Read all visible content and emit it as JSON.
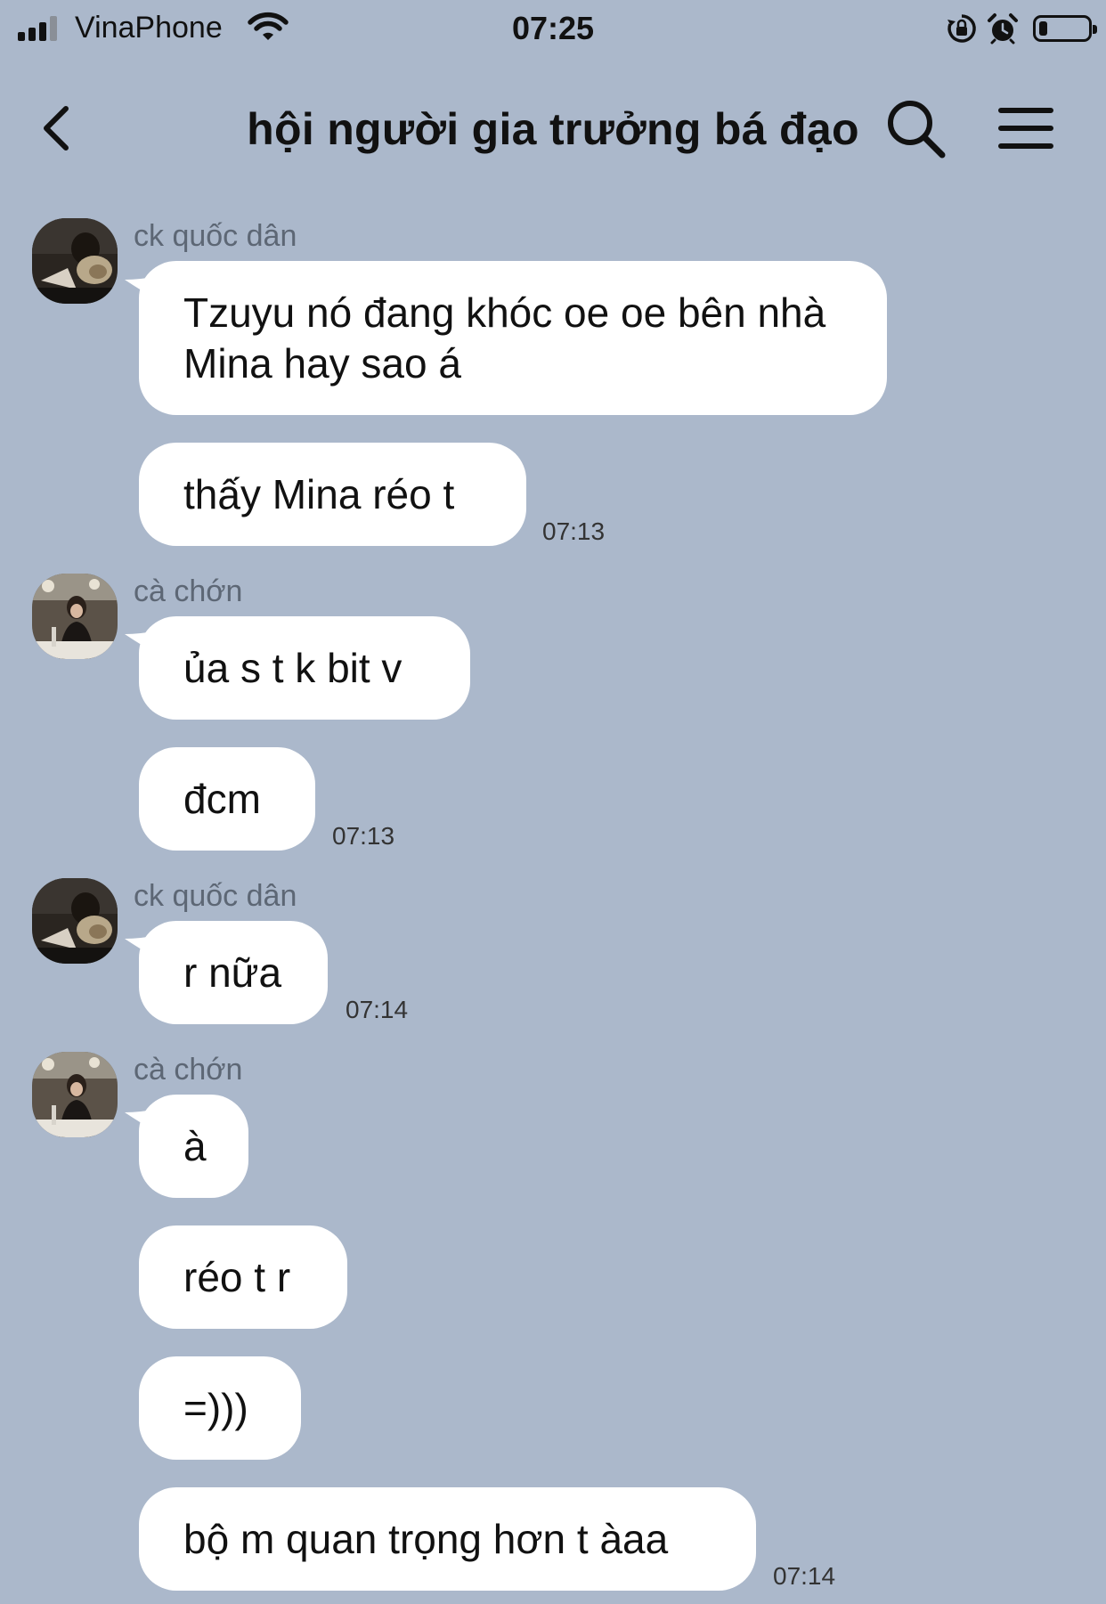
{
  "status_bar": {
    "carrier": "VinaPhone",
    "time": "07:25",
    "battery_level": 0.18
  },
  "header": {
    "title": "hội người gia trưởng bá đạo",
    "icons": [
      "back-chevron-icon",
      "search-icon",
      "hamburger-menu-icon"
    ]
  },
  "messages": [
    {
      "sender": "ck quốc dân",
      "items": [
        {
          "text": "Tzuyu nó đang khóc oe oe bên nhà Mina hay sao á"
        },
        {
          "text": "thấy Mina réo t",
          "time": "07:13"
        }
      ]
    },
    {
      "sender": "cà chớn",
      "items": [
        {
          "text": "ủa s t k bit v"
        },
        {
          "text": "đcm",
          "time": "07:13"
        }
      ]
    },
    {
      "sender": "ck quốc dân",
      "items": [
        {
          "text": "r nữa",
          "time": "07:14"
        }
      ]
    },
    {
      "sender": "cà chớn",
      "items": [
        {
          "text": "à"
        },
        {
          "text": "réo t r"
        },
        {
          "text": "=)))"
        },
        {
          "text": "bộ m quan trọng hơn t àaa",
          "time": "07:14"
        }
      ]
    }
  ],
  "colors": {
    "background": "#abb8cb",
    "bubble": "#ffffff",
    "sender_name": "#5d6775"
  }
}
